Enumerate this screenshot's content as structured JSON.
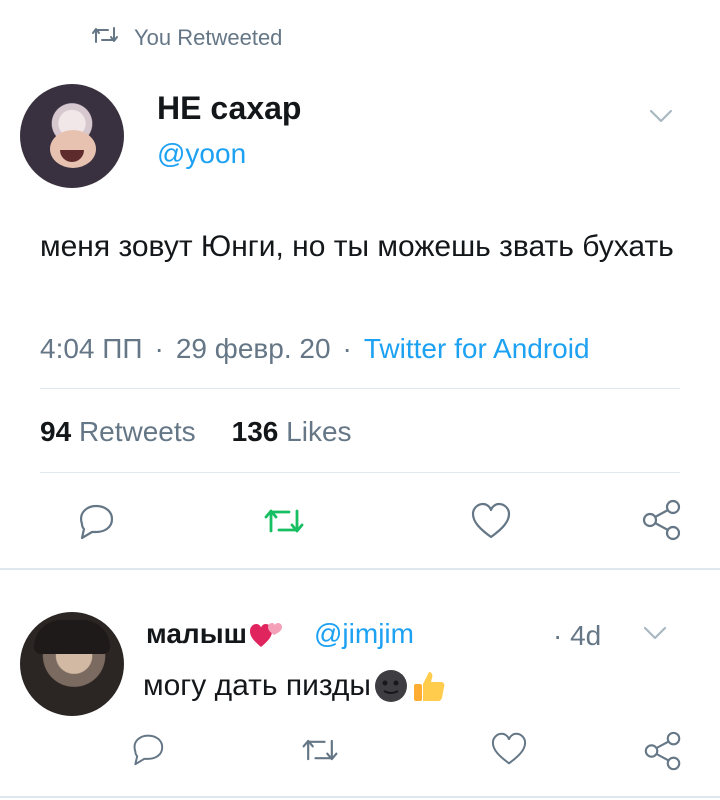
{
  "retweet_banner": {
    "text": "You Retweeted"
  },
  "tweet": {
    "author_name": "НЕ сахар",
    "author_handle": "@yoon",
    "text": "меня зовут Юнги, но ты можешь звать бухать",
    "time": "4:04 ПП",
    "date": "29 февр. 20",
    "source": "Twitter for Android",
    "separator": "·",
    "retweets_count": "94",
    "retweets_label": "Retweets",
    "likes_count": "136",
    "likes_label": "Likes"
  },
  "reply": {
    "author_name": "малыш",
    "author_handle": "@jimjim",
    "time": "· 4d",
    "text": "могу дать пизды"
  },
  "colors": {
    "accent": "#1da1f2",
    "retweet_active": "#17bf63",
    "muted": "#657786",
    "divider": "#e1e8ed"
  },
  "icons": [
    "retweet-icon",
    "chevron-down-icon",
    "reply-icon",
    "heart-icon",
    "share-icon",
    "two-hearts-emoji",
    "new-moon-face-emoji",
    "thumbs-up-emoji"
  ]
}
